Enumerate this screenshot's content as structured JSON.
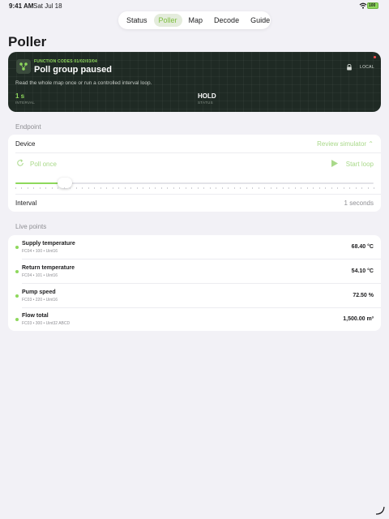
{
  "status_bar": {
    "time": "9:41 AM",
    "date": "Sat Jul 18",
    "battery": "100"
  },
  "tabs": [
    {
      "label": "Status",
      "active": false
    },
    {
      "label": "Poller",
      "active": true
    },
    {
      "label": "Map",
      "active": false
    },
    {
      "label": "Decode",
      "active": false
    },
    {
      "label": "Guide",
      "active": false
    }
  ],
  "page_title": "Poller",
  "hero": {
    "eyebrow": "FUNCTION CODES 01/02/03/04",
    "title": "Poll group paused",
    "description": "Read the whole map once or run a controlled interval loop.",
    "badge": "LOCAL",
    "metrics": [
      {
        "value": "1 s",
        "label": "INTERVAL"
      },
      {
        "value": "HOLD",
        "label": "STATUS"
      }
    ]
  },
  "endpoint": {
    "header": "Endpoint",
    "device_label": "Device",
    "device_value": "Review simulator",
    "poll_once": "Poll once",
    "start_loop": "Start loop",
    "slider_fraction": 0.05,
    "interval_label": "Interval",
    "interval_value": "1 seconds"
  },
  "live_points": {
    "header": "Live points",
    "items": [
      {
        "name": "Supply temperature",
        "meta": "FC04 • 100 • Uint16",
        "value": "68.40 °C"
      },
      {
        "name": "Return temperature",
        "meta": "FC04 • 101 • Uint16",
        "value": "54.10 °C"
      },
      {
        "name": "Pump speed",
        "meta": "FC03 • 220 • Uint16",
        "value": "72.50 %"
      },
      {
        "name": "Flow total",
        "meta": "FC03 • 300 • Uint32 ABCD",
        "value": "1,500.00 m³"
      }
    ]
  },
  "colors": {
    "accent": "#8ed85c",
    "accent_soft": "#a9d98a",
    "hero_bg": "#1f2a24",
    "page_bg": "#f2f1f6"
  }
}
